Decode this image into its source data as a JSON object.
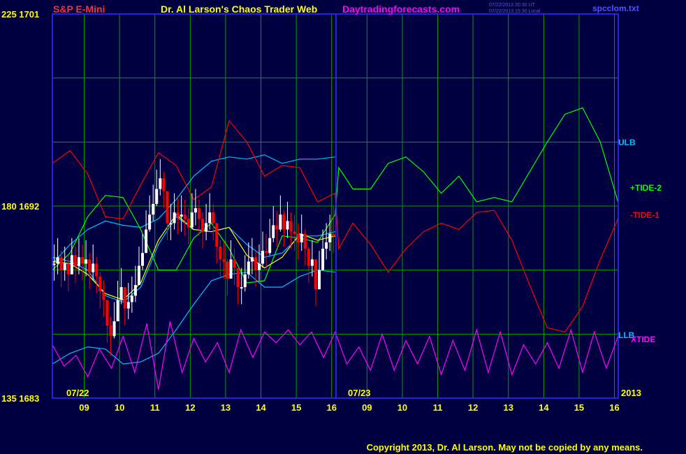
{
  "header": {
    "instrument": "S&P E-Mini",
    "title": "Dr. Al Larson's Chaos Trader Web",
    "site": "Daytradingforecasts.com",
    "time_utc": "07/22/2013 20:30 UT",
    "time_local": "07/22/2013 15:30 Local",
    "file": "spcclom.txt"
  },
  "footer": {
    "copyright": "Copyright 2013, Dr. Al Larson. May not be copied by any means."
  },
  "colors": {
    "background": "#000040",
    "grid": "#00a000",
    "frame": "#3030ff",
    "price_up": "#ffffff",
    "price_down": "#ff0000",
    "avg": "#ffff00",
    "ulb_llb": "#00c0ff",
    "tide_plus": "#00ff00",
    "tide_minus": "#ff0000",
    "xtide": "#ff00ff",
    "copyright": "#ffff00"
  },
  "chart_data": {
    "type": "line",
    "xlabel": "",
    "ylabel": "",
    "y_axis_left": [
      {
        "value": 1701,
        "label": "225 1701"
      },
      {
        "value": 1692,
        "label": "180 1692"
      },
      {
        "value": 1683,
        "label": "135 1683"
      }
    ],
    "ylim": [
      1683,
      1701
    ],
    "x_hour_ticks": [
      "09",
      "10",
      "11",
      "12",
      "13",
      "14",
      "15",
      "16",
      "09",
      "10",
      "11",
      "12",
      "13",
      "14",
      "15",
      "16"
    ],
    "date_labels": [
      "07/22",
      "07/23",
      "2013"
    ],
    "right_labels": [
      {
        "text": "ULB",
        "color": "#00c0ff"
      },
      {
        "text": "+TIDE-2",
        "color": "#00ff00"
      },
      {
        "text": "-TIDE-1",
        "color": "#ff0000"
      },
      {
        "text": "LLB",
        "color": "#00c0ff"
      },
      {
        "text": "XTIDE",
        "color": "#ff00ff"
      }
    ],
    "grid": true,
    "series": [
      {
        "name": "ULB",
        "color": "#00c0ff",
        "x": [
          0,
          0.5,
          1,
          1.5,
          2,
          2.5,
          3,
          3.5,
          4,
          4.5,
          5,
          5.5,
          6,
          6.5,
          7,
          7.5,
          8
        ],
        "y": [
          1689.3,
          1690.2,
          1690.9,
          1691.3,
          1691.1,
          1691.0,
          1691.4,
          1692.3,
          1693.4,
          1694.1,
          1694.3,
          1694.2,
          1694.4,
          1694.0,
          1694.2,
          1694.2,
          1694.3
        ]
      },
      {
        "name": "LLB",
        "color": "#00c0ff",
        "x": [
          0,
          0.5,
          1,
          1.5,
          2,
          2.5,
          3,
          3.5,
          4,
          4.5,
          5,
          5.5,
          6,
          6.5,
          7,
          7.5,
          8
        ],
        "y": [
          1684.6,
          1685.1,
          1685.4,
          1685.3,
          1684.6,
          1684.7,
          1685.1,
          1686.2,
          1687.4,
          1688.5,
          1688.8,
          1688.9,
          1688.2,
          1688.2,
          1688.7,
          1689.0,
          1688.9
        ]
      },
      {
        "name": "+TIDE-2",
        "color": "#00ff00",
        "x": [
          0,
          0.5,
          1,
          1.5,
          2,
          2.5,
          3,
          3.5,
          4,
          4.5,
          5,
          5.5,
          6,
          6.5,
          7,
          7.5,
          8,
          8.1,
          8.5,
          9,
          9.5,
          10,
          10.5,
          11,
          11.5,
          12,
          12.5,
          13,
          13.5,
          14,
          14.5,
          15,
          15.5,
          16
        ],
        "y": [
          1689.0,
          1689.8,
          1691.5,
          1692.5,
          1692.4,
          1690.9,
          1689.0,
          1689.0,
          1690.5,
          1691.2,
          1690.0,
          1688.4,
          1688.5,
          1690.6,
          1690.5,
          1690.3,
          1691.6,
          1693.8,
          1692.8,
          1692.8,
          1694.0,
          1694.3,
          1693.6,
          1692.6,
          1693.4,
          1692.2,
          1692.4,
          1692.2,
          1693.6,
          1695.0,
          1696.3,
          1696.6,
          1695.0,
          1692.2
        ]
      },
      {
        "name": "-TIDE-1",
        "color": "#ff0000",
        "x": [
          0,
          0.5,
          1,
          1.5,
          2,
          2.5,
          3,
          3.5,
          4,
          4.5,
          5,
          5.5,
          6,
          6.5,
          7,
          7.5,
          8,
          8.1,
          8.5,
          9,
          9.5,
          10,
          10.5,
          11,
          11.5,
          12,
          12.5,
          13,
          13.5,
          14,
          14.5,
          15,
          15.5,
          16
        ],
        "y": [
          1694.0,
          1694.6,
          1693.5,
          1691.5,
          1691.4,
          1693.0,
          1694.5,
          1693.9,
          1692.3,
          1692.9,
          1696.0,
          1695.0,
          1693.4,
          1693.9,
          1693.8,
          1692.2,
          1692.6,
          1690.0,
          1691.2,
          1690.2,
          1688.9,
          1690.0,
          1690.8,
          1691.2,
          1690.9,
          1691.7,
          1691.8,
          1690.4,
          1688.3,
          1686.3,
          1686.1,
          1687.3,
          1689.5,
          1691.4
        ]
      },
      {
        "name": "XTIDE",
        "color": "#ff00ff",
        "x": [
          0,
          0.33,
          0.67,
          1,
          1.33,
          1.67,
          2,
          2.33,
          2.67,
          3,
          3.33,
          3.67,
          4,
          4.33,
          4.67,
          5,
          5.33,
          5.67,
          6,
          6.33,
          6.67,
          7,
          7.33,
          7.67,
          8,
          8.33,
          8.67,
          9,
          9.33,
          9.67,
          10,
          10.33,
          10.67,
          11,
          11.33,
          11.67,
          12,
          12.33,
          12.67,
          13,
          13.33,
          13.67,
          14,
          14.33,
          14.67,
          15,
          15.33,
          15.67,
          16
        ],
        "y": [
          1685.5,
          1684.5,
          1685.0,
          1684.0,
          1685.3,
          1684.4,
          1685.9,
          1684.2,
          1686.5,
          1683.4,
          1686.6,
          1684.2,
          1685.8,
          1684.7,
          1685.6,
          1684.2,
          1686.2,
          1684.9,
          1686.1,
          1685.6,
          1686.2,
          1685.5,
          1686.1,
          1684.9,
          1686.1,
          1684.6,
          1685.4,
          1684.3,
          1686.0,
          1684.3,
          1685.7,
          1684.6,
          1685.9,
          1684.1,
          1685.7,
          1684.3,
          1686.2,
          1684.2,
          1686.1,
          1684.1,
          1685.5,
          1684.6,
          1685.6,
          1684.4,
          1686.2,
          1684.2,
          1686.1,
          1684.4,
          1685.9
        ]
      },
      {
        "name": "Fast Avg",
        "color": "#00c0ff",
        "x": [
          0,
          0.5,
          1,
          1.5,
          2,
          2.5,
          3,
          3.5,
          4,
          4.5,
          5,
          5.5,
          6,
          6.5,
          7,
          7.5,
          8
        ],
        "y": [
          1689.6,
          1689.4,
          1689.0,
          1687.8,
          1687.5,
          1688.2,
          1690.2,
          1691.5,
          1690.9,
          1690.8,
          1691.0,
          1690.2,
          1689.6,
          1689.8,
          1690.6,
          1690.6,
          1690.8
        ]
      },
      {
        "name": "Slow Avg",
        "color": "#ffff00",
        "x": [
          0,
          0.5,
          1,
          1.5,
          2,
          2.5,
          3,
          3.5,
          4,
          4.5,
          5,
          5.5,
          6,
          6.5,
          7,
          7.5,
          8
        ],
        "y": [
          1689.4,
          1689.3,
          1688.8,
          1687.9,
          1687.6,
          1688.4,
          1690.4,
          1691.6,
          1690.9,
          1690.8,
          1691.0,
          1689.7,
          1689.1,
          1689.6,
          1690.7,
          1690.4,
          1690.6
        ]
      }
    ],
    "price": {
      "x": [
        0.05,
        0.15,
        0.25,
        0.35,
        0.45,
        0.55,
        0.65,
        0.75,
        0.85,
        0.95,
        1.05,
        1.15,
        1.25,
        1.35,
        1.45,
        1.55,
        1.65,
        1.75,
        1.85,
        1.95,
        2.05,
        2.15,
        2.25,
        2.35,
        2.45,
        2.55,
        2.65,
        2.75,
        2.85,
        2.95,
        3.05,
        3.15,
        3.25,
        3.35,
        3.45,
        3.55,
        3.65,
        3.75,
        3.85,
        3.95,
        4.05,
        4.15,
        4.25,
        4.35,
        4.45,
        4.55,
        4.65,
        4.75,
        4.85,
        4.95,
        5.05,
        5.15,
        5.25,
        5.35,
        5.45,
        5.55,
        5.65,
        5.75,
        5.85,
        5.95,
        6.05,
        6.15,
        6.25,
        6.35,
        6.45,
        6.55,
        6.65,
        6.75,
        6.85,
        6.95,
        7.05,
        7.15,
        7.25,
        7.35,
        7.45,
        7.55,
        7.65,
        7.75,
        7.85,
        7.95
      ],
      "close": [
        1689.3,
        1689.6,
        1689.0,
        1689.3,
        1688.8,
        1689.7,
        1689.2,
        1689.6,
        1689.3,
        1689.5,
        1688.9,
        1689.3,
        1688.7,
        1688.0,
        1687.6,
        1686.4,
        1685.9,
        1686.6,
        1687.6,
        1688.2,
        1687.2,
        1687.5,
        1687.8,
        1688.3,
        1689.2,
        1689.8,
        1690.9,
        1691.6,
        1692.1,
        1692.8,
        1693.3,
        1692.7,
        1691.2,
        1691.2,
        1691.7,
        1691.5,
        1691.6,
        1691.4,
        1691.0,
        1691.7,
        1691.9,
        1691.4,
        1690.8,
        1691.2,
        1691.7,
        1691.2,
        1690.1,
        1689.5,
        1689.4,
        1688.6,
        1689.5,
        1689.1,
        1688.2,
        1688.2,
        1688.8,
        1689.4,
        1689.6,
        1689.0,
        1689.3,
        1689.9,
        1689.8,
        1690.5,
        1691.1,
        1690.9,
        1691.6,
        1690.9,
        1691.3,
        1690.8,
        1690.7,
        1690.3,
        1690.7,
        1690.0,
        1689.2,
        1689.5,
        1688.1,
        1689.0,
        1690.0,
        1690.3,
        1690.7,
        1690.6
      ],
      "high": [
        1690.2,
        1690.5,
        1689.9,
        1690.1,
        1689.7,
        1690.5,
        1690.1,
        1690.5,
        1690.2,
        1690.4,
        1689.8,
        1690.2,
        1689.6,
        1688.9,
        1688.5,
        1687.3,
        1686.8,
        1687.5,
        1688.5,
        1689.1,
        1688.1,
        1688.4,
        1688.7,
        1689.2,
        1690.1,
        1690.7,
        1691.8,
        1692.5,
        1693.0,
        1693.7,
        1694.2,
        1693.6,
        1692.1,
        1692.1,
        1692.6,
        1692.4,
        1692.5,
        1692.3,
        1691.9,
        1692.6,
        1692.8,
        1692.3,
        1691.7,
        1692.1,
        1692.6,
        1692.1,
        1691.0,
        1690.4,
        1690.3,
        1689.5,
        1690.4,
        1690.0,
        1689.1,
        1689.1,
        1689.7,
        1690.3,
        1690.5,
        1689.9,
        1690.2,
        1690.8,
        1690.7,
        1691.4,
        1692.0,
        1691.8,
        1692.5,
        1691.8,
        1692.2,
        1691.7,
        1691.6,
        1691.2,
        1691.6,
        1690.9,
        1690.1,
        1690.4,
        1689.0,
        1689.9,
        1690.9,
        1691.2,
        1691.6,
        1692.0
      ],
      "low": [
        1688.5,
        1688.8,
        1688.2,
        1688.5,
        1688.0,
        1688.9,
        1688.4,
        1688.8,
        1688.5,
        1688.7,
        1688.1,
        1688.5,
        1687.9,
        1687.2,
        1686.8,
        1685.6,
        1685.0,
        1685.8,
        1686.8,
        1687.4,
        1686.4,
        1686.7,
        1687.0,
        1687.5,
        1688.4,
        1689.0,
        1690.1,
        1690.8,
        1691.3,
        1692.0,
        1692.5,
        1691.9,
        1690.4,
        1690.4,
        1690.9,
        1690.7,
        1690.8,
        1690.6,
        1690.2,
        1690.9,
        1691.1,
        1690.6,
        1690.0,
        1690.4,
        1690.9,
        1690.4,
        1689.3,
        1688.7,
        1688.6,
        1687.8,
        1688.7,
        1688.3,
        1687.4,
        1687.4,
        1688.0,
        1688.6,
        1688.8,
        1688.2,
        1688.5,
        1689.1,
        1689.0,
        1689.7,
        1690.3,
        1690.1,
        1690.8,
        1690.1,
        1690.5,
        1690.0,
        1689.9,
        1689.5,
        1689.9,
        1689.2,
        1688.4,
        1688.7,
        1687.3,
        1688.2,
        1689.2,
        1689.5,
        1689.9,
        1689.8
      ]
    }
  }
}
